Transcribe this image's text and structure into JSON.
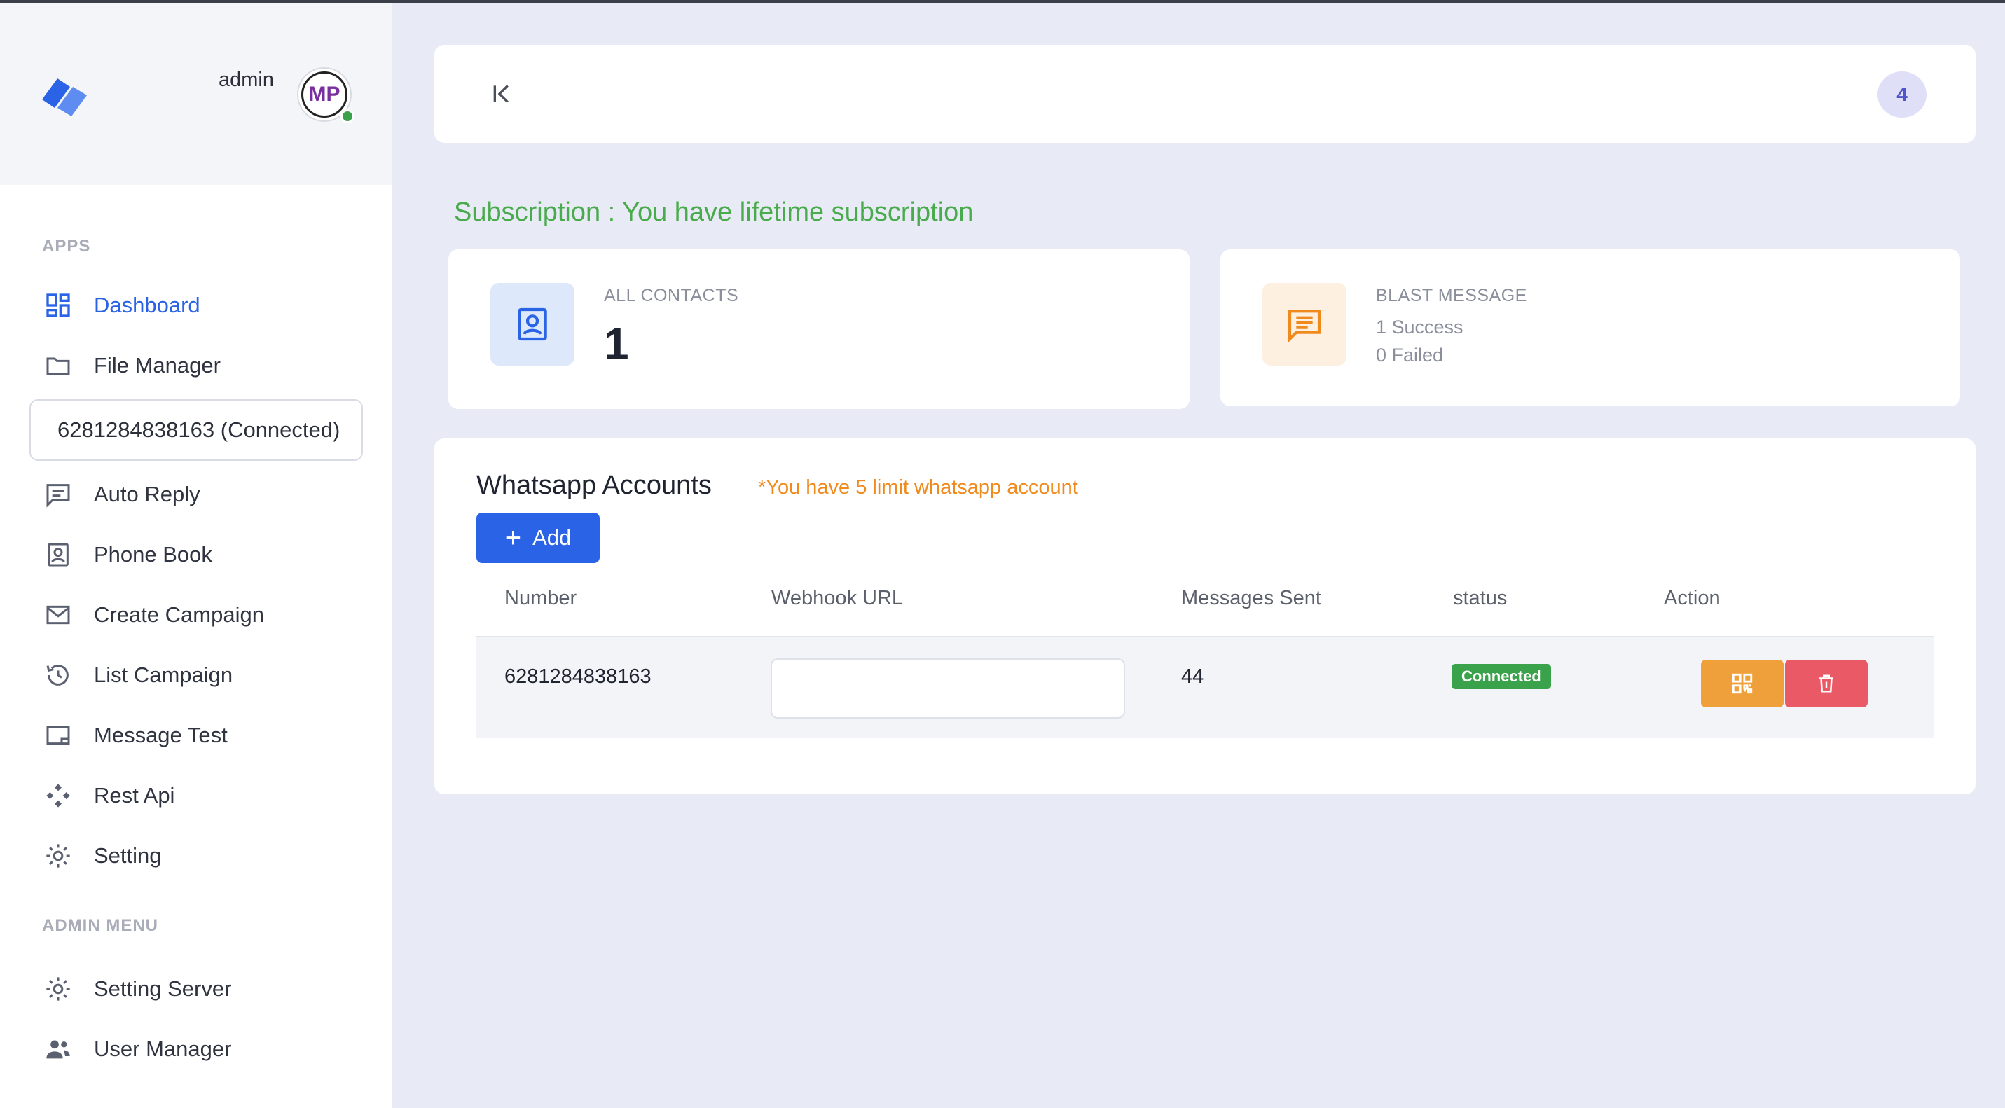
{
  "header": {
    "user_name": "admin",
    "avatar_initials": "MP",
    "notification_count": "4"
  },
  "sidebar": {
    "apps_label": "APPS",
    "admin_label": "ADMIN MENU",
    "device": "6281284838163 (Connected)",
    "items": [
      {
        "label": "Dashboard",
        "icon": "dashboard-icon"
      },
      {
        "label": "File Manager",
        "icon": "folder-icon"
      },
      {
        "label": "Auto Reply",
        "icon": "message-icon"
      },
      {
        "label": "Phone Book",
        "icon": "contact-book-icon"
      },
      {
        "label": "Create Campaign",
        "icon": "mail-icon"
      },
      {
        "label": "List Campaign",
        "icon": "history-icon"
      },
      {
        "label": "Message Test",
        "icon": "note-icon"
      },
      {
        "label": "Rest Api",
        "icon": "api-icon"
      },
      {
        "label": "Setting",
        "icon": "gear-icon"
      }
    ],
    "admin_items": [
      {
        "label": "Setting Server",
        "icon": "gear-icon"
      },
      {
        "label": "User Manager",
        "icon": "users-icon"
      }
    ]
  },
  "subscription": "Subscription : You have lifetime subscription",
  "stats": {
    "contacts": {
      "label": "ALL CONTACTS",
      "value": "1"
    },
    "blast": {
      "label": "BLAST MESSAGE",
      "success": "1 Success",
      "failed": "0 Failed"
    }
  },
  "accounts": {
    "title": "Whatsapp Accounts",
    "limit_note": "*You have 5 limit whatsapp account",
    "add_label": "Add",
    "columns": [
      "Number",
      "Webhook URL",
      "Messages Sent",
      "status",
      "Action"
    ],
    "rows": [
      {
        "number": "6281284838163",
        "webhook": "",
        "messages_sent": "44",
        "status": "Connected"
      }
    ]
  },
  "colors": {
    "accent": "#2b63e6",
    "success": "#3aa24a",
    "warning": "#f0a03a",
    "danger": "#ea5a66",
    "subscription_text": "#4aab4d"
  }
}
